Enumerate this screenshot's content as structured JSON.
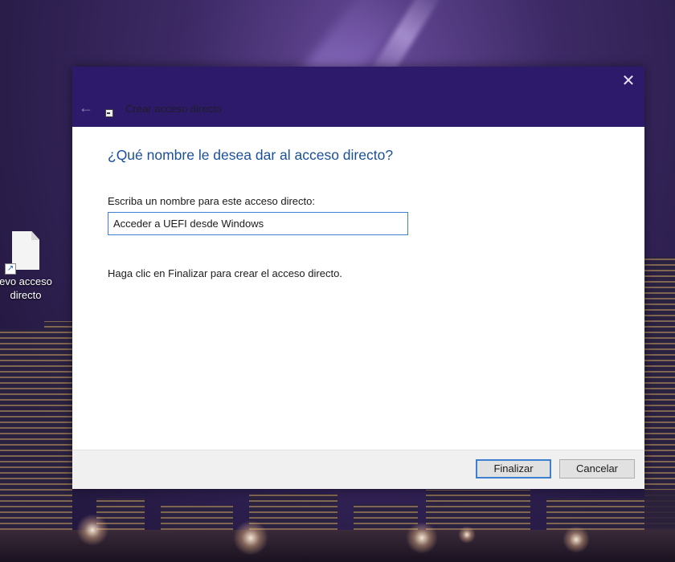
{
  "desktop": {
    "icon_label_line1": "evo acceso",
    "icon_label_line2": "directo",
    "icon_name": "shortcut-file-icon"
  },
  "dialog": {
    "title": "Crear acceso directo",
    "heading": "¿Qué nombre le desea dar al acceso directo?",
    "name_label": "Escriba un nombre para este acceso directo:",
    "name_value": "Acceder a UEFI desde Windows",
    "instruction": "Haga clic en Finalizar para crear el acceso directo.",
    "finish_label": "Finalizar",
    "cancel_label": "Cancelar",
    "close_glyph": "✕",
    "back_glyph": "←"
  },
  "colors": {
    "titlebar": "#2d1a6b",
    "heading": "#1a4f9c",
    "focus_border": "#3d7fd1"
  }
}
